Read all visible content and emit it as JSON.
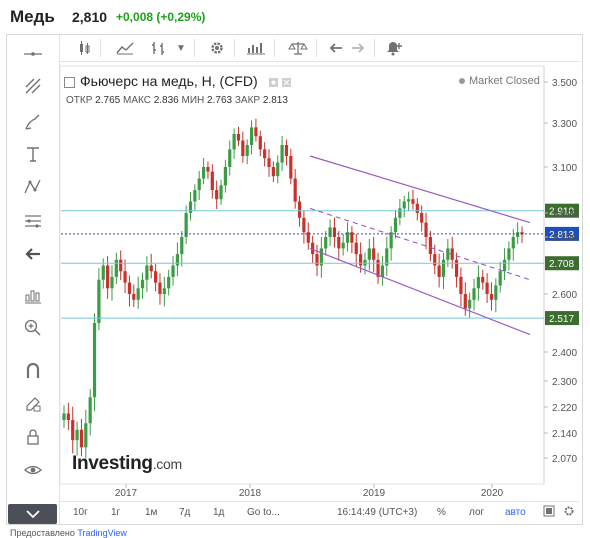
{
  "header": {
    "title": "Медь",
    "price": "2,810",
    "change": "+0,008 (+0,29%)"
  },
  "chart": {
    "title": "Фьючерс на медь, H, (CFD)",
    "ohlc": {
      "open_label": "ОТКР",
      "open": "2.765",
      "high_label": "МАКС",
      "high": "2.836",
      "low_label": "МИН",
      "low": "2.763",
      "close_label": "ЗАКР",
      "close": "2.813"
    },
    "status": "Market Closed",
    "logo_main": "Investing",
    "logo_suffix": ".com"
  },
  "price_axis": {
    "ticks": [
      "3.500",
      "3.300",
      "3.100",
      "2.900",
      "2.800",
      "2.600",
      "2.400",
      "2.300",
      "2.220",
      "2.140",
      "2.070"
    ]
  },
  "price_labels": {
    "resistance": "2.910",
    "current": "2.813",
    "support1": "2.708",
    "support2": "2.517"
  },
  "time_axis": {
    "labels": [
      "2017",
      "2018",
      "2019",
      "2020"
    ]
  },
  "bottom_toolbar": {
    "ranges": [
      "10г",
      "1г",
      "1м",
      "7д",
      "1д"
    ],
    "goto": "Go to...",
    "time": "16:14:49 (UTC+3)",
    "percent": "%",
    "log": "лог",
    "auto": "авто"
  },
  "footer": {
    "prefix": "Предоставлено",
    "link": "TradingView"
  },
  "colors": {
    "up": "#3a9c45",
    "down": "#c8322c",
    "channel": "#9b59c6",
    "hline": "#76c6de",
    "current": "#2c4fa3",
    "label_bg": "#3a6d2e"
  },
  "chart_data": {
    "type": "candlestick",
    "title": "Фьючерс на медь, H, (CFD)",
    "x_ticks": [
      "2017",
      "2018",
      "2019",
      "2020"
    ],
    "y_ticks": [
      3.5,
      3.3,
      3.1,
      2.9,
      2.8,
      2.6,
      2.4,
      2.3,
      2.22,
      2.14,
      2.07
    ],
    "series": [
      {
        "values": [
          2.2,
          2.18,
          2.12,
          2.15,
          2.1,
          2.17,
          2.25,
          2.5,
          2.65,
          2.7,
          2.62,
          2.66,
          2.72,
          2.68,
          2.64,
          2.6,
          2.58,
          2.62,
          2.65,
          2.7,
          2.68,
          2.64,
          2.6,
          2.62,
          2.66,
          2.7,
          2.74,
          2.8,
          2.9,
          2.95,
          3.0,
          3.05,
          3.1,
          3.08,
          3.0,
          2.96,
          3.02,
          3.1,
          3.18,
          3.25,
          3.22,
          3.15,
          3.2,
          3.28,
          3.24,
          3.18,
          3.14,
          3.1,
          3.06,
          3.12,
          3.2,
          3.15,
          3.05,
          2.95,
          2.88,
          2.82,
          2.78,
          2.74,
          2.7,
          2.76,
          2.8,
          2.84,
          2.8,
          2.76,
          2.78,
          2.82,
          2.78,
          2.74,
          2.7,
          2.72,
          2.76,
          2.72,
          2.66,
          2.7,
          2.76,
          2.82,
          2.88,
          2.92,
          2.95,
          2.96,
          2.94,
          2.9,
          2.86,
          2.8,
          2.74,
          2.7,
          2.66,
          2.72,
          2.76,
          2.72,
          2.66,
          2.6,
          2.55,
          2.58,
          2.62,
          2.66,
          2.64,
          2.6,
          2.58,
          2.63,
          2.68,
          2.72,
          2.76,
          2.8,
          2.82,
          2.81
        ]
      }
    ]
  }
}
